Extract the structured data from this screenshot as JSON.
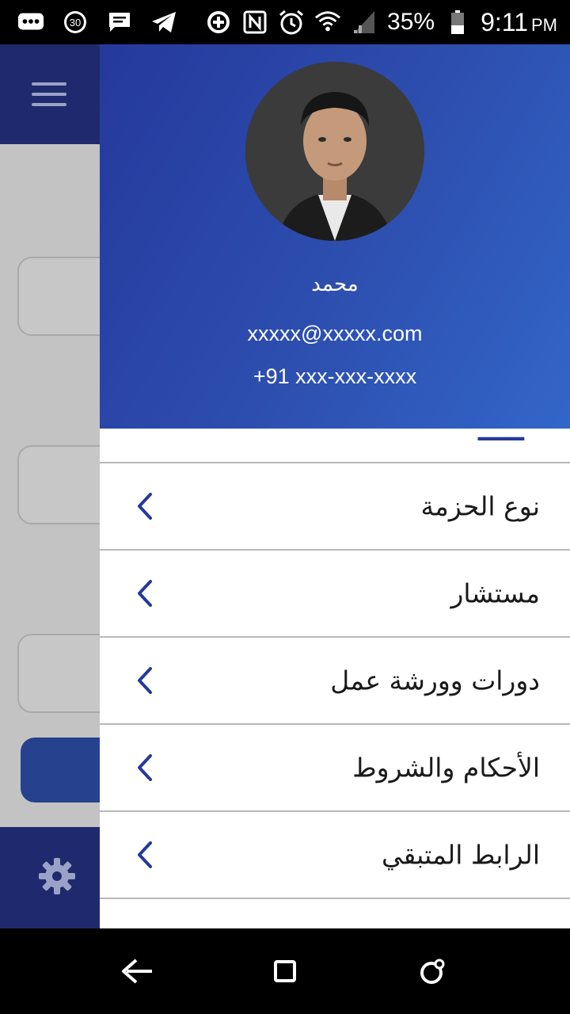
{
  "status_bar": {
    "battery_percent": "35%",
    "time": "9:11",
    "ampm": "PM",
    "left_icons": [
      "chat-bubble-icon",
      "circle-30-icon",
      "message-icon",
      "telegram-icon"
    ],
    "right_icons": [
      "data-saver-icon",
      "nfc-icon",
      "alarm-icon",
      "wifi-icon",
      "signal-icon",
      "battery-icon"
    ]
  },
  "drawer": {
    "header": {
      "name": "محمد",
      "email": "xxxxx@xxxxx.com",
      "phone": "+91 xxx-xxx-xxxx"
    },
    "menu_items": [
      {
        "label": "نوع الحزمة",
        "icon": "chevron-left-icon"
      },
      {
        "label": "مستشار",
        "icon": "chevron-left-icon"
      },
      {
        "label": "دورات وورشة عمل",
        "icon": "chevron-left-icon"
      },
      {
        "label": "الأحكام والشروط",
        "icon": "chevron-left-icon"
      },
      {
        "label": "الرابط المتبقي",
        "icon": "chevron-left-icon"
      }
    ]
  },
  "background_app": {
    "menu_icon": "hamburger-icon",
    "settings_icon": "gear-icon"
  },
  "nav_bar": {
    "icons": [
      "back-icon",
      "recents-icon",
      "home-icon"
    ]
  },
  "colors": {
    "primary": "#1f2a6e",
    "header_gradient_start": "#25399c",
    "header_gradient_end": "#3266c8",
    "chevron": "#25399c",
    "divider": "#b8b8b8"
  }
}
